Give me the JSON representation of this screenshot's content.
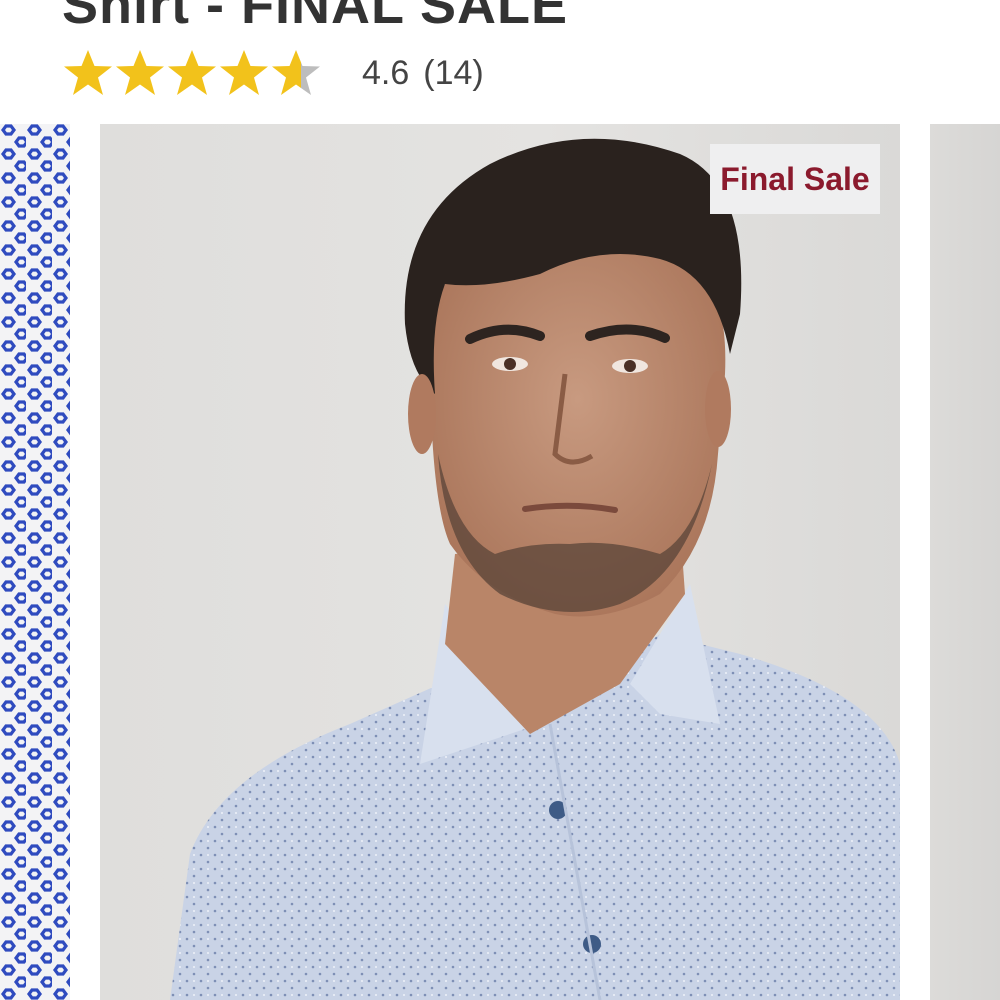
{
  "product": {
    "title": "Shirt - FINAL SALE",
    "rating": {
      "value": 4.6,
      "value_label": "4.6",
      "count_label": "(14)",
      "max_stars": 5,
      "star_color": "#f2c21b",
      "star_empty_color": "#bdbdbd"
    }
  },
  "gallery": {
    "badge_label": "Final Sale",
    "badge_color": "#8b1a2d",
    "pattern_color": "#2f4bbf"
  }
}
